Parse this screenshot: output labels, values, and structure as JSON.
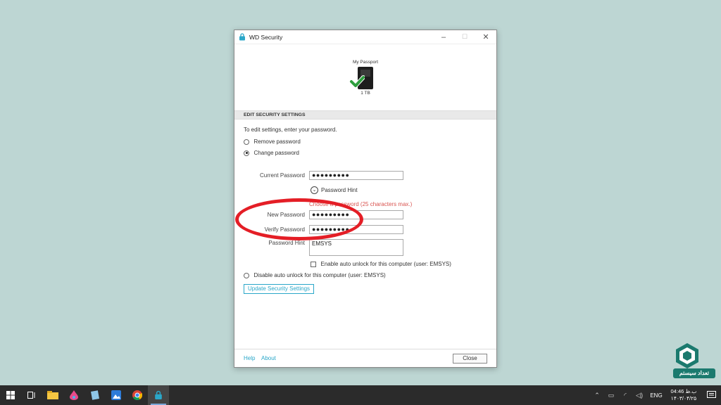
{
  "window": {
    "title": "WD Security",
    "minimize_glyph": "–",
    "maximize_glyph": "☐",
    "close_glyph": "✕"
  },
  "device": {
    "name": "My Passport",
    "capacity": "1 TB",
    "status_icon": "green-check-icon"
  },
  "section": {
    "header": "EDIT SECURITY SETTINGS",
    "instruction": "To edit settings, enter your password."
  },
  "options": {
    "remove_password": "Remove password",
    "change_password": "Change password",
    "selected": "change_password"
  },
  "form": {
    "current_password_label": "Current Password",
    "current_password_value": "●●●●●●●●●",
    "password_hint_toggle": "Password Hint",
    "error_text": "Choose a password (25 characters max.)",
    "new_password_label": "New Password",
    "new_password_value": "●●●●●●●●●",
    "verify_password_label": "Verify Password",
    "verify_password_value": "●●●●●●●●●",
    "password_hint_label": "Password Hint",
    "password_hint_value": "EMSYS",
    "enable_auto_unlock": "Enable auto unlock for this computer (user: EMSYS)",
    "disable_auto_unlock": "Disable auto unlock for this computer (user: EMSYS)"
  },
  "buttons": {
    "update": "Update Security Settings",
    "close": "Close"
  },
  "footer": {
    "help": "Help",
    "about": "About"
  },
  "brand": {
    "text": "تعداد سیستم"
  },
  "taskbar": {
    "language": "ENG",
    "time": "04:46 ب.ظ",
    "date": "۱۴۰۳/۰۴/۲۵",
    "apps": [
      "windows-start-icon",
      "task-view-icon",
      "file-explorer-icon",
      "paint-icon",
      "notepad-icon",
      "photos-icon",
      "chrome-icon",
      "wd-security-icon"
    ]
  },
  "colors": {
    "accent": "#2aa7c9",
    "error": "#d9534f",
    "highlight": "#e41e26",
    "desktop": "#bdd6d3"
  }
}
